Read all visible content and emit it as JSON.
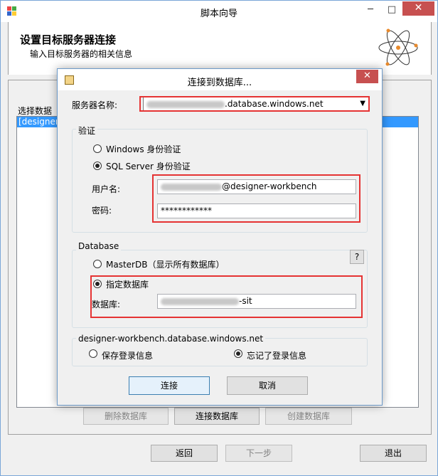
{
  "window": {
    "title": "脚本向导",
    "minimize": "─",
    "maximize": "□",
    "close": "✕"
  },
  "header": {
    "title": "设置目标服务器连接",
    "subtitle": "输入目标服务器的相关信息"
  },
  "panel": {
    "group_label": "选择数据",
    "selected_item": "[designer",
    "buttons": {
      "delete_db": "删除数据库",
      "connect_db": "连接数据库",
      "create_db": "创建数据库"
    }
  },
  "footer": {
    "back": "返回",
    "next": "下一步",
    "exit": "退出"
  },
  "dialog": {
    "title": "连接到数据库...",
    "close": "✕",
    "server_label": "服务器名称:",
    "server_value_suffix": ".database.windows.net",
    "auth_group": "验证",
    "windows_auth": "Windows 身份验证",
    "sql_auth": "SQL Server 身份验证",
    "username_label": "用户名:",
    "username_suffix": "@designer-workbench",
    "password_label": "密码:",
    "password_value": "************",
    "database_group": "Database",
    "help": "?",
    "masterdb_option": "MasterDB（显示所有数据库）",
    "specify_option": "指定数据库",
    "database_label": "数据库:",
    "database_suffix": "-sit",
    "save_group": "designer-workbench.database.windows.net",
    "save_login": "保存登录信息",
    "forget_login": "忘记了登录信息",
    "connect": "连接",
    "cancel": "取消"
  },
  "colors": {
    "highlight_box": "#e53333",
    "selection": "#3399ff",
    "close_button": "#c75050"
  }
}
